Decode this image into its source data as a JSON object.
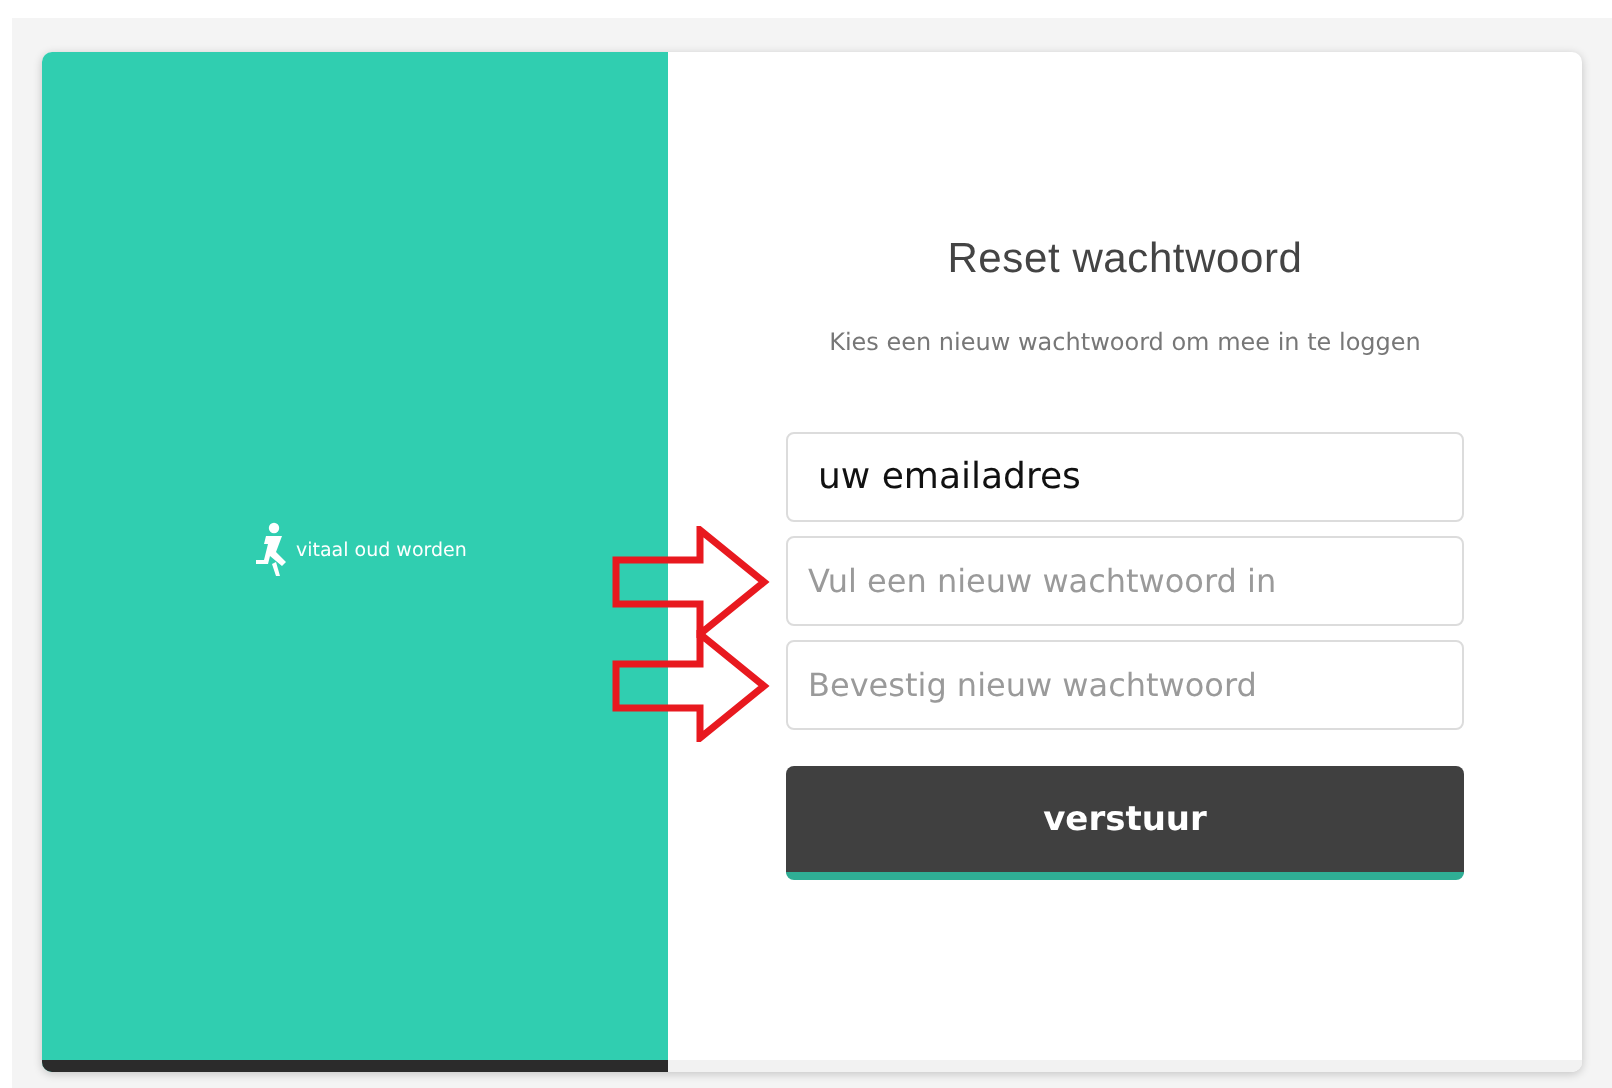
{
  "brand": {
    "name": "vitaal oud worden"
  },
  "form": {
    "title": "Reset wachtwoord",
    "subtitle": "Kies een nieuw wachtwoord om mee in te loggen",
    "fields": [
      {
        "value": "uw emailadres",
        "annotated": false
      },
      {
        "placeholder": "Vul een nieuw wachtwoord in",
        "annotated": true
      },
      {
        "placeholder": "Bevestig nieuw wachtwoord",
        "annotated": true
      }
    ],
    "button": "verstuur"
  }
}
